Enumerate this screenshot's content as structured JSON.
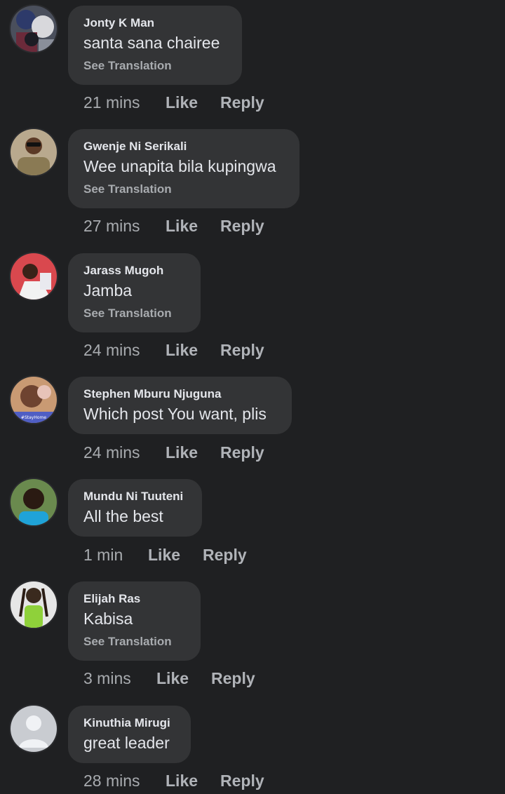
{
  "comments": [
    {
      "author": "Jonty K Man",
      "text": "santa sana chairee",
      "translation_label": "See Translation",
      "time": "21 mins",
      "like_label": "Like",
      "reply_label": "Reply"
    },
    {
      "author": "Gwenje Ni Serikali",
      "text": "Wee unapita bila kupingwa",
      "translation_label": "See Translation",
      "time": "27 mins",
      "like_label": "Like",
      "reply_label": "Reply"
    },
    {
      "author": "Jarass Mugoh",
      "text": "Jamba",
      "translation_label": "See Translation",
      "time": "24 mins",
      "like_label": "Like",
      "reply_label": "Reply"
    },
    {
      "author": "Stephen Mburu Njuguna",
      "text": "Which post You want, plis",
      "time": "24 mins",
      "like_label": "Like",
      "reply_label": "Reply",
      "avatar_badge": "#StayHome"
    },
    {
      "author": "Mundu Ni Tuuteni",
      "text": "All the best",
      "time": "1 min",
      "like_label": "Like",
      "reply_label": "Reply"
    },
    {
      "author": "Elijah Ras",
      "text": "Kabisa",
      "translation_label": "See Translation",
      "time": "3 mins",
      "like_label": "Like",
      "reply_label": "Reply"
    },
    {
      "author": "Kinuthia Mirugi",
      "text": "great leader",
      "time": "28 mins",
      "like_label": "Like",
      "reply_label": "Reply"
    }
  ]
}
